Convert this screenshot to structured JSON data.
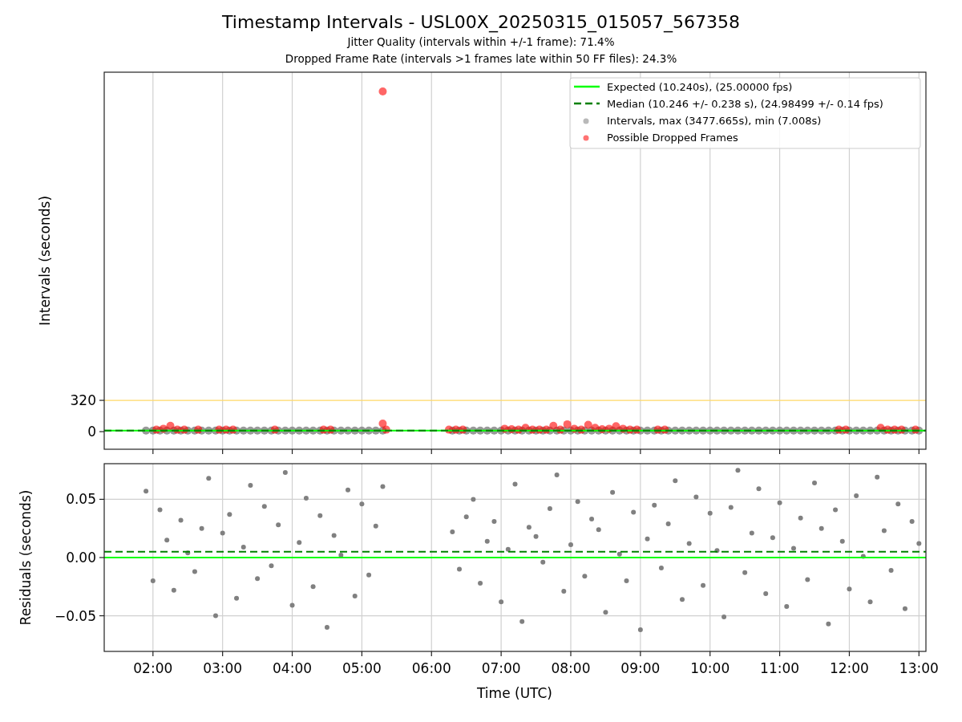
{
  "figure": {
    "title": "Timestamp Intervals - USL00X_20250315_015057_567358",
    "subtitles": [
      "Jitter Quality (intervals within +/-1 frame): 71.4%",
      "Dropped Frame Rate (intervals >1 frames late within 50 FF files): 24.3%"
    ]
  },
  "intervals_plot": {
    "chart_data": {
      "type": "scatter",
      "ylabel": "Intervals (seconds)",
      "xlim": [
        1.3,
        13.1
      ],
      "ylim": [
        -180,
        3675
      ],
      "yticks": [
        {
          "value": 0,
          "label": "0"
        },
        {
          "value": 320,
          "label": "320"
        }
      ],
      "grid": true,
      "legend": true,
      "ref_lines": [
        {
          "axis": "y",
          "value": 320,
          "color": "#ffd966"
        }
      ],
      "series": [
        {
          "name": "Expected (10.240s), (25.00000 fps)",
          "type": "line",
          "color": "#00ff00",
          "x": [
            1.3,
            13.1
          ],
          "values": [
            10,
            10
          ]
        },
        {
          "name": "Median (10.246 +/- 0.238 s), (24.98499 +/- 0.14 fps)",
          "type": "line",
          "line_style": "dashed",
          "color": "#008000",
          "x": [
            1.3,
            13.1
          ],
          "values": [
            10,
            10
          ]
        },
        {
          "name": "Intervals, max (3477.665s), min (7.008s)",
          "color": "#808080",
          "x": [
            1.9,
            2.0,
            2.1,
            2.2,
            2.3,
            2.4,
            2.5,
            2.6,
            2.7,
            2.8,
            2.9,
            3.0,
            3.1,
            3.2,
            3.3,
            3.4,
            3.5,
            3.6,
            3.7,
            3.8,
            3.9,
            4.0,
            4.1,
            4.2,
            4.3,
            4.4,
            4.5,
            4.6,
            4.7,
            4.8,
            4.9,
            5.0,
            5.1,
            5.2,
            5.3,
            6.3,
            6.4,
            6.5,
            6.6,
            6.7,
            6.8,
            6.9,
            7.0,
            7.1,
            7.2,
            7.3,
            7.4,
            7.5,
            7.6,
            7.7,
            7.8,
            7.9,
            8.0,
            8.1,
            8.2,
            8.3,
            8.4,
            8.5,
            8.6,
            8.7,
            8.8,
            8.9,
            9.0,
            9.1,
            9.2,
            9.3,
            9.4,
            9.5,
            9.6,
            9.7,
            9.8,
            9.9,
            10.0,
            10.1,
            10.2,
            10.3,
            10.4,
            10.5,
            10.6,
            10.7,
            10.8,
            10.9,
            11.0,
            11.1,
            11.2,
            11.3,
            11.4,
            11.5,
            11.6,
            11.7,
            11.8,
            11.9,
            12.0,
            12.1,
            12.2,
            12.3,
            12.4,
            12.5,
            12.6,
            12.7,
            12.8,
            12.9,
            13.0
          ],
          "values": [
            10.2,
            10.2,
            10.2,
            10.2,
            10.2,
            10.2,
            10.2,
            10.2,
            10.2,
            10.2,
            10.2,
            10.2,
            10.2,
            10.2,
            10.2,
            10.2,
            10.2,
            10.2,
            10.2,
            10.2,
            10.2,
            10.2,
            10.2,
            10.2,
            10.2,
            10.2,
            10.2,
            10.2,
            10.2,
            10.2,
            10.2,
            10.2,
            10.2,
            10.2,
            10.2,
            10.2,
            10.2,
            10.2,
            10.2,
            10.2,
            10.2,
            10.2,
            10.2,
            10.2,
            10.2,
            10.2,
            10.2,
            10.2,
            10.2,
            10.2,
            10.2,
            10.2,
            10.2,
            10.2,
            10.2,
            10.2,
            10.2,
            10.2,
            10.2,
            10.2,
            10.2,
            10.2,
            10.2,
            10.2,
            10.2,
            10.2,
            10.2,
            10.2,
            10.2,
            10.2,
            10.2,
            10.2,
            10.2,
            10.2,
            10.2,
            10.2,
            10.2,
            10.2,
            10.2,
            10.2,
            10.2,
            10.2,
            10.2,
            10.2,
            10.2,
            10.2,
            10.2,
            10.2,
            10.2,
            10.2,
            10.2,
            10.2,
            10.2,
            10.2,
            10.2,
            10.2,
            10.2,
            10.2,
            10.2,
            10.2,
            10.2,
            10.2,
            10.2
          ]
        },
        {
          "name": "Possible Dropped Frames",
          "color": "#ff0000",
          "x": [
            2.05,
            2.15,
            2.25,
            2.35,
            2.45,
            2.65,
            2.95,
            3.05,
            3.15,
            3.75,
            4.45,
            4.55,
            5.3,
            5.3,
            5.35,
            6.25,
            6.35,
            6.45,
            7.05,
            7.15,
            7.25,
            7.35,
            7.45,
            7.55,
            7.65,
            7.75,
            7.85,
            7.95,
            8.05,
            8.15,
            8.25,
            8.35,
            8.45,
            8.55,
            8.65,
            8.75,
            8.85,
            8.95,
            9.25,
            9.35,
            11.85,
            11.95,
            12.45,
            12.55,
            12.65,
            12.75,
            12.95
          ],
          "values": [
            20,
            30,
            60,
            20,
            20,
            20,
            20,
            20,
            20,
            20,
            20,
            20,
            3478,
            82,
            20,
            20,
            20,
            20,
            30,
            25,
            20,
            40,
            20,
            20,
            20,
            60,
            20,
            75,
            30,
            20,
            70,
            40,
            25,
            30,
            55,
            30,
            20,
            20,
            20,
            20,
            20,
            20,
            40,
            20,
            20,
            20,
            20
          ]
        }
      ]
    }
  },
  "residuals_plot": {
    "chart_data": {
      "type": "scatter",
      "grid": true,
      "xlabel": "Time (UTC)",
      "ylabel": "Residuals (seconds)",
      "xlim": [
        1.3,
        13.1
      ],
      "ylim": [
        -0.0806,
        0.0806
      ],
      "xticks": [
        {
          "value": 2,
          "label": "02:00"
        },
        {
          "value": 3,
          "label": "03:00"
        },
        {
          "value": 4,
          "label": "04:00"
        },
        {
          "value": 5,
          "label": "05:00"
        },
        {
          "value": 6,
          "label": "06:00"
        },
        {
          "value": 7,
          "label": "07:00"
        },
        {
          "value": 8,
          "label": "08:00"
        },
        {
          "value": 9,
          "label": "09:00"
        },
        {
          "value": 10,
          "label": "10:00"
        },
        {
          "value": 11,
          "label": "11:00"
        },
        {
          "value": 12,
          "label": "12:00"
        },
        {
          "value": 13,
          "label": "13:00"
        }
      ],
      "yticks": [
        {
          "value": -0.05,
          "label": "−0.05"
        },
        {
          "value": 0,
          "label": "0.00"
        },
        {
          "value": 0.05,
          "label": "0.05"
        }
      ],
      "series": [
        {
          "type": "line",
          "color": "#00ff00",
          "x": [
            1.3,
            13.1
          ],
          "values": [
            0,
            0
          ]
        },
        {
          "type": "line",
          "line_style": "dashed",
          "color": "#008000",
          "x": [
            1.3,
            13.1
          ],
          "values": [
            0.005,
            0.005
          ]
        },
        {
          "color": "#808080",
          "x": [
            1.9,
            2.0,
            2.1,
            2.2,
            2.3,
            2.4,
            2.5,
            2.6,
            2.7,
            2.8,
            2.9,
            3.0,
            3.1,
            3.2,
            3.3,
            3.4,
            3.5,
            3.6,
            3.7,
            3.8,
            3.9,
            4.0,
            4.1,
            4.2,
            4.3,
            4.4,
            4.5,
            4.6,
            4.7,
            4.8,
            4.9,
            5.0,
            5.1,
            5.2,
            5.3,
            6.3,
            6.4,
            6.5,
            6.6,
            6.7,
            6.8,
            6.9,
            7.0,
            7.1,
            7.2,
            7.3,
            7.4,
            7.5,
            7.6,
            7.7,
            7.8,
            7.9,
            8.0,
            8.1,
            8.2,
            8.3,
            8.4,
            8.5,
            8.6,
            8.7,
            8.8,
            8.9,
            9.0,
            9.1,
            9.2,
            9.3,
            9.4,
            9.5,
            9.6,
            9.7,
            9.8,
            9.9,
            10.0,
            10.1,
            10.2,
            10.3,
            10.4,
            10.5,
            10.6,
            10.7,
            10.8,
            10.9,
            11.0,
            11.1,
            11.2,
            11.3,
            11.4,
            11.5,
            11.6,
            11.7,
            11.8,
            11.9,
            12.0,
            12.1,
            12.2,
            12.3,
            12.4,
            12.5,
            12.6,
            12.7,
            12.8,
            12.9,
            13.0
          ],
          "values": [
            0.057,
            -0.02,
            0.041,
            0.015,
            -0.028,
            0.032,
            0.004,
            -0.012,
            0.025,
            0.068,
            -0.05,
            0.021,
            0.037,
            -0.035,
            0.009,
            0.062,
            -0.018,
            0.044,
            -0.007,
            0.028,
            0.073,
            -0.041,
            0.013,
            0.051,
            -0.025,
            0.036,
            -0.06,
            0.019,
            0.002,
            0.058,
            -0.033,
            0.046,
            -0.015,
            0.027,
            0.061,
            0.022,
            -0.01,
            0.035,
            0.05,
            -0.022,
            0.014,
            0.031,
            -0.038,
            0.007,
            0.063,
            -0.055,
            0.026,
            0.018,
            -0.004,
            0.042,
            0.071,
            -0.029,
            0.011,
            0.048,
            -0.016,
            0.033,
            0.024,
            -0.047,
            0.056,
            0.003,
            -0.02,
            0.039,
            -0.062,
            0.016,
            0.045,
            -0.009,
            0.029,
            0.066,
            -0.036,
            0.012,
            0.052,
            -0.024,
            0.038,
            0.006,
            -0.051,
            0.043,
            0.075,
            -0.013,
            0.021,
            0.059,
            -0.031,
            0.017,
            0.047,
            -0.042,
            0.008,
            0.034,
            -0.019,
            0.064,
            0.025,
            -0.057,
            0.041,
            0.014,
            -0.027,
            0.053,
            0.001,
            -0.038,
            0.069,
            0.023,
            -0.011,
            0.046,
            -0.044,
            0.031,
            0.012
          ]
        }
      ]
    }
  }
}
